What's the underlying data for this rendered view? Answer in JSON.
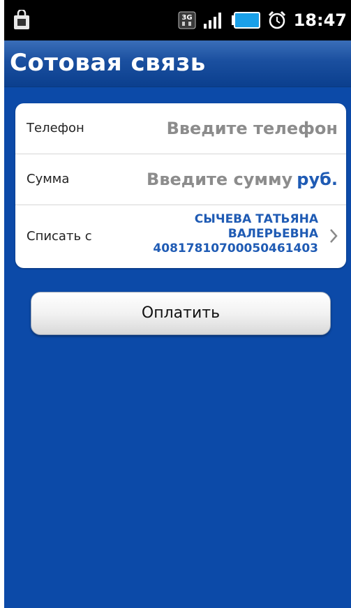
{
  "status_bar": {
    "time": "18:47",
    "icons": [
      "shopping-bag-icon",
      "3g-icon",
      "signal-icon",
      "battery-icon",
      "alarm-icon"
    ]
  },
  "header": {
    "title": "Сотовая связь"
  },
  "form": {
    "phone": {
      "label": "Телефон",
      "placeholder": "Введите телефон"
    },
    "amount": {
      "label": "Сумма",
      "placeholder": "Введите сумму",
      "currency": "руб."
    },
    "source": {
      "label": "Списать с",
      "account_line1": "СЫЧЕВА ТАТЬЯНА",
      "account_line2": "ВАЛЕРЬЕВНА",
      "account_number": "40817810700050461403"
    }
  },
  "actions": {
    "pay_label": "Оплатить"
  },
  "colors": {
    "background": "#0c4aa8",
    "accent": "#1f5bb4",
    "placeholder": "#8c8c8c"
  }
}
